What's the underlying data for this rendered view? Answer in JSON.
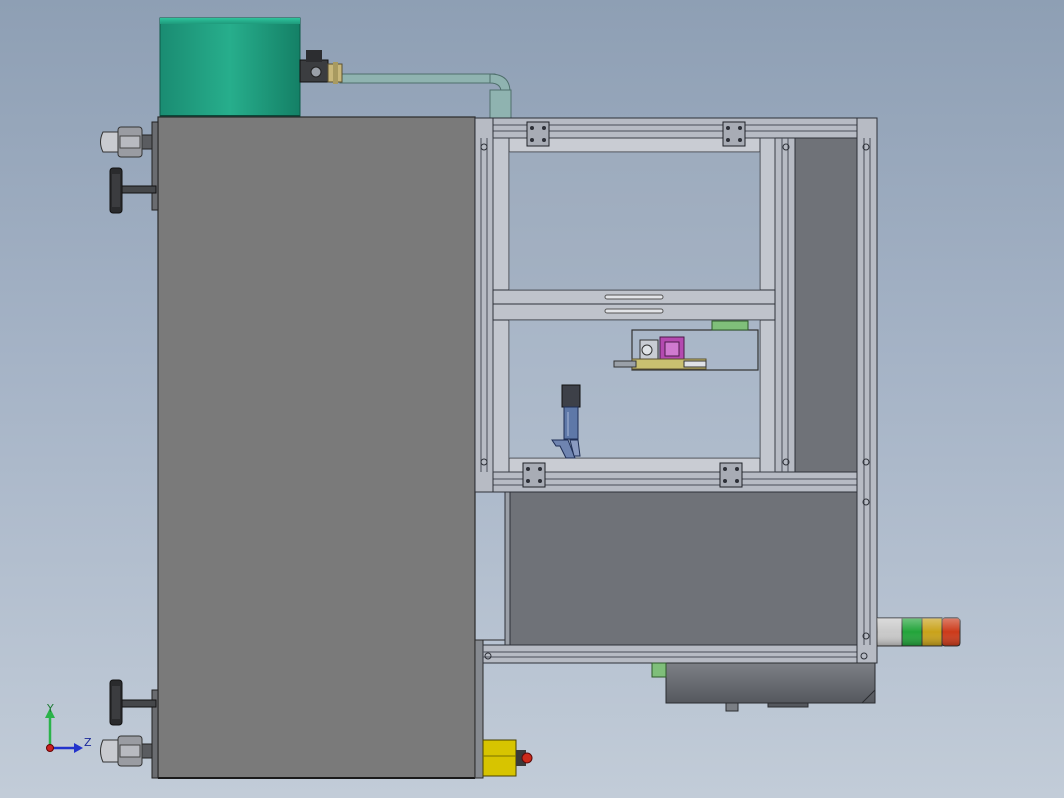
{
  "viewport": {
    "background_top": "#8e9fb4",
    "background_bottom": "#c2ccd8"
  },
  "triad": {
    "y_label": "Y",
    "z_label": "Z",
    "y_color": "#2bb34a",
    "z_color": "#2233cc",
    "x_color": "#cc2222"
  },
  "colors": {
    "tank": "#1f9e80",
    "cabinet": "#7a7a7a",
    "frame": "#b8bcc6",
    "panel": "#6f7278",
    "pipe": "#8fb3b0",
    "button_box": "#d7c400"
  },
  "stack_light": {
    "segments": [
      "clear",
      "green",
      "amber",
      "red"
    ],
    "colors": [
      "#c9c9c9",
      "#22a43a",
      "#c9a21a",
      "#cc3a1a"
    ]
  }
}
